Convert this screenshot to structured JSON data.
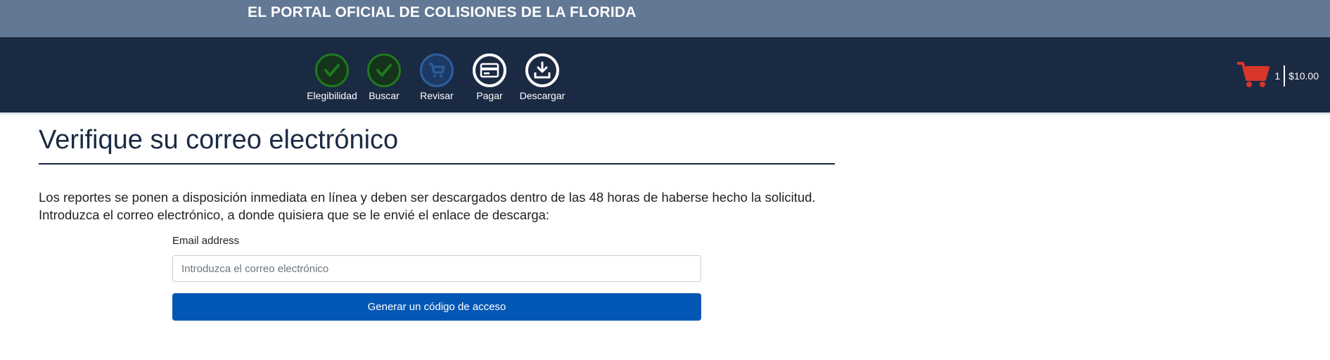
{
  "header": {
    "site_title": "EL PORTAL OFICIAL DE COLISIONES DE LA FLORIDA"
  },
  "steps": [
    {
      "label": "Elegibilidad",
      "state": "done",
      "icon": "check-icon"
    },
    {
      "label": "Buscar",
      "state": "done",
      "icon": "check-icon"
    },
    {
      "label": "Revisar",
      "state": "current",
      "icon": "cart-icon"
    },
    {
      "label": "Pagar",
      "state": "todo",
      "icon": "credit-card-icon"
    },
    {
      "label": "Descargar",
      "state": "todo",
      "icon": "download-icon"
    }
  ],
  "cart": {
    "count": "1",
    "total": "$10.00",
    "icon": "shopping-cart-icon"
  },
  "main": {
    "title": "Verifique su correo electrónico",
    "intro_line1": "Los reportes se ponen a disposición inmediata en línea y deben ser descargados dentro de las 48 horas de haberse hecho la solicitud.",
    "intro_line2": "Introduzca el correo electrónico, a donde quisiera que se le envié el enlace de descarga:",
    "email_label": "Email address",
    "email_placeholder": "Introduzca el correo electrónico",
    "email_value": "",
    "submit_label": "Generar un código de acceso"
  },
  "colors": {
    "banner": "#627894",
    "nav": "#1b2a43",
    "done": "#1e7a1e",
    "current": "#2b5f9e",
    "cart": "#d9362b",
    "button": "#0257b5"
  }
}
